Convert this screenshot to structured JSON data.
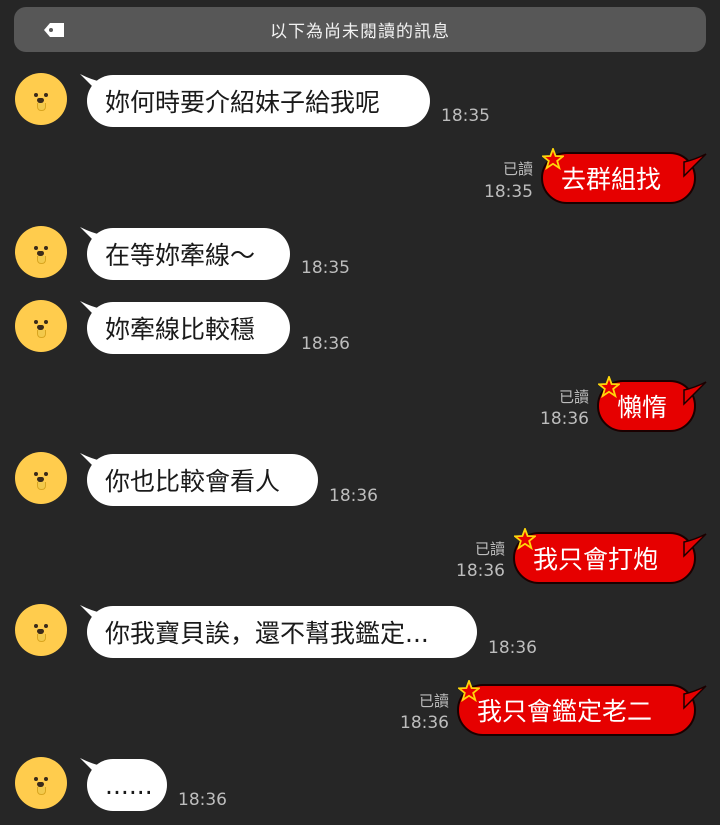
{
  "banner": {
    "text": "以下為尚未閱讀的訊息",
    "icon": "tag-icon"
  },
  "colors": {
    "background": "#262626",
    "incoming_bubble": "#ffffff",
    "outgoing_bubble": "#e60000",
    "avatar": "#ffcc4d"
  },
  "messages": [
    {
      "direction": "in",
      "text": "妳何時要介紹妹子給我呢",
      "time": "18:35"
    },
    {
      "direction": "out",
      "text": "去群組找",
      "time": "18:35",
      "read": "已讀"
    },
    {
      "direction": "in",
      "text": "在等妳牽線～",
      "time": "18:35"
    },
    {
      "direction": "in",
      "text": "妳牽線比較穩",
      "time": "18:36"
    },
    {
      "direction": "out",
      "text": "懶惰",
      "time": "18:36",
      "read": "已讀"
    },
    {
      "direction": "in",
      "text": "你也比較會看人",
      "time": "18:36"
    },
    {
      "direction": "out",
      "text": "我只會打炮",
      "time": "18:36",
      "read": "已讀"
    },
    {
      "direction": "in",
      "text": "你我寶貝誒，還不幫我鑑定...",
      "time": "18:36"
    },
    {
      "direction": "out",
      "text": "我只會鑑定老二",
      "time": "18:36",
      "read": "已讀"
    },
    {
      "direction": "in",
      "text": "......",
      "time": "18:36"
    }
  ]
}
